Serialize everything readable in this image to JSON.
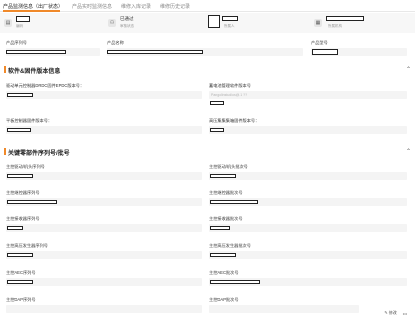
{
  "tabs": [
    {
      "label": "产品监测信息（出厂状态）",
      "active": true
    },
    {
      "label": "产品实时监测信息",
      "active": false
    },
    {
      "label": "维修入库记录",
      "active": false
    },
    {
      "label": "维修历史记录",
      "active": false
    }
  ],
  "summary": {
    "card1_label": "编码",
    "card2_status": "已通过",
    "card2_label": "审核状态",
    "card3_label": "所属人",
    "card4_label": "所属机构"
  },
  "basic": {
    "product_sn_label": "产品序列号",
    "product_name_label": "产品名称",
    "product_model_label": "产品型号"
  },
  "software": {
    "title": "软件&固件版本信息",
    "drive_label": "驱动单元控制器DRDC固件EPDC版本号：",
    "bms_label": "蓄电池管理软件版本号",
    "bms_placeholder": "Pangolinstudios@.1 ??",
    "panel_label": "平板控制器固件版本号：",
    "hv_label": "高压集集集箱固件版本号："
  },
  "parts": {
    "title": "关键零部件序列号/批号",
    "main_drive_sn": "主控驱动/机头序列号",
    "main_drive_batch": "主控驱动/机头批次号",
    "main_battery_sn": "主控继控器序列号",
    "main_battery_batch": "主控继控器批次号",
    "main_lift_sn": "主控接收器序列号",
    "main_lift_batch": "主控接收器批次号",
    "main_hv_sn": "主控高压发生器序列号",
    "main_hv_batch": "主控高压发生器批次号",
    "main_aec_sn": "主控AEC序列号",
    "main_aec_batch": "主控AEC批次号",
    "main_dap_sn": "主控DAP序列号",
    "main_dap_batch": "主控DAP批次号"
  },
  "footer": {
    "edit_label": "修改",
    "more_label": "•••"
  }
}
